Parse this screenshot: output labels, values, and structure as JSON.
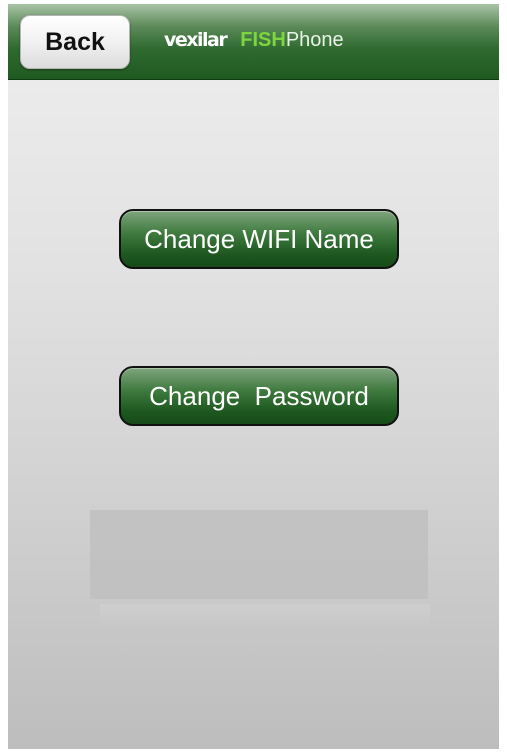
{
  "navbar": {
    "back_label": "Back",
    "logo": {
      "brand": "vexilar",
      "product_bold": "FISH",
      "product_light": "Phone"
    }
  },
  "main": {
    "buttons": [
      {
        "label": "Change WIFI Name"
      },
      {
        "label": "Change  Password"
      }
    ]
  },
  "colors": {
    "navbar_green": "#1f5a21",
    "button_green": "#2f6a2f",
    "logo_fish_green": "#7dd63f",
    "background_gray": "#dcdcdc"
  },
  "icons": []
}
